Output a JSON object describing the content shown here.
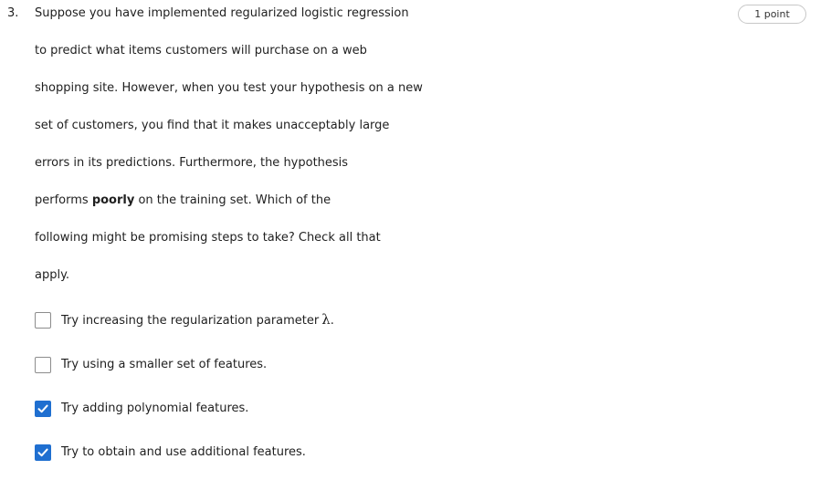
{
  "question": {
    "number": "3.",
    "points": "1 point",
    "prompt_lines": [
      "Suppose you have implemented regularized logistic regression",
      "to predict what items customers will purchase on a web",
      "shopping site. However, when you test your hypothesis on a new",
      "set of customers, you find that it makes unacceptably large",
      "errors in its predictions. Furthermore, the hypothesis"
    ],
    "line6": {
      "before": "performs ",
      "bold": "poorly",
      "after": " on the training set. Which of the"
    },
    "prompt_lines_end": [
      "following might be promising steps to take? Check all that",
      "apply."
    ]
  },
  "options": [
    {
      "label": "Try increasing the regularization parameter",
      "symbol": "λ",
      "suffix": ".",
      "checked": false
    },
    {
      "label": "Try using a smaller set of features.",
      "checked": false
    },
    {
      "label": "Try adding polynomial features.",
      "checked": true
    },
    {
      "label": "Try to obtain and use additional features.",
      "checked": true
    }
  ],
  "colors": {
    "checkbox_checked": "#1f6fd0"
  }
}
